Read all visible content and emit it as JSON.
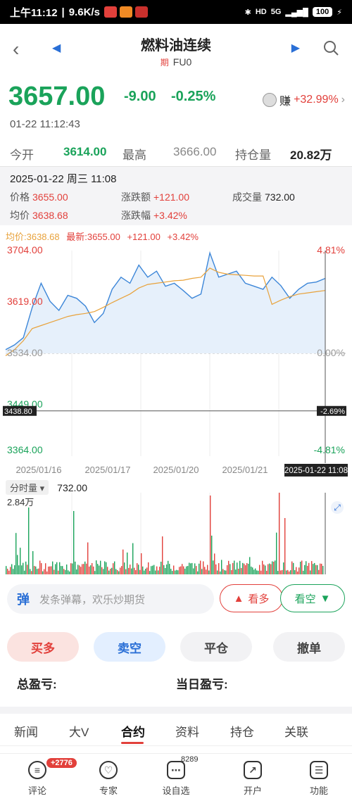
{
  "status_bar": {
    "time": "上午11:12",
    "speed": "9.6K/s",
    "net": "5G",
    "battery": "100"
  },
  "nav": {
    "title": "燃料油连续",
    "tag": "期",
    "code": "FU0"
  },
  "quote": {
    "price": "3657.00",
    "change": "-9.00",
    "change_pct": "-0.25%",
    "earn_label": "赚",
    "earn_value": "+32.99%",
    "timestamp": "01-22 11:12:43",
    "open_label": "今开",
    "open_value": "3614.00",
    "high_label": "最高",
    "high_value": "3666.00",
    "oi_label": "持仓量",
    "oi_value": "20.82万"
  },
  "popup": {
    "date": "2025-01-22 周三 11:08",
    "price_label": "价格",
    "price_value": "3655.00",
    "chg_label": "涨跌额",
    "chg_value": "+121.00",
    "vol_label": "成交量",
    "vol_value": "732.00",
    "avg_label": "均价",
    "avg_value": "3638.68",
    "pct_label": "涨跌幅",
    "pct_value": "+3.42%"
  },
  "legend": {
    "avg": "均价:3638.68",
    "latest": "最新:3655.00",
    "chg": "+121.00",
    "pct": "+3.42%"
  },
  "chart_data": {
    "type": "line",
    "x": [
      "2025/01/16",
      "2025/01/17",
      "2025/01/20",
      "2025/01/21"
    ],
    "ylim": [
      3364.0,
      3704.0
    ],
    "y_ticks_left": [
      "3704.00",
      "3619.00",
      "3534.00",
      "3449.00",
      "3364.00"
    ],
    "y_ticks_right": [
      "4.81%",
      "0.00%",
      "-4.81%"
    ],
    "crosshair_y": "3438.80",
    "crosshair_pct": "-2.69%",
    "crosshair_x": "2025-01-22 11:08",
    "series": [
      {
        "name": "最新",
        "values": [
          3540,
          3548,
          3560,
          3610,
          3650,
          3620,
          3605,
          3630,
          3625,
          3612,
          3585,
          3600,
          3640,
          3660,
          3650,
          3680,
          3660,
          3670,
          3645,
          3650,
          3638,
          3625,
          3632,
          3700,
          3660,
          3665,
          3670,
          3650,
          3645,
          3640,
          3660,
          3646,
          3625,
          3640,
          3650,
          3652,
          3658
        ]
      },
      {
        "name": "均价",
        "values": [
          3530,
          3540,
          3555,
          3575,
          3580,
          3585,
          3590,
          3595,
          3598,
          3600,
          3603,
          3610,
          3618,
          3625,
          3632,
          3642,
          3648,
          3650,
          3652,
          3654,
          3655,
          3658,
          3660,
          3675,
          3668,
          3665,
          3664,
          3663,
          3662,
          3662,
          3615,
          3622,
          3628,
          3632,
          3634,
          3636,
          3638
        ]
      }
    ],
    "volume": {
      "label": "分时量",
      "value": "732.00",
      "max": "2.84万"
    }
  },
  "danmu": {
    "placeholder": "发条弹幕，欢乐炒期货",
    "icon": "弹",
    "bull": "看多",
    "bear": "看空"
  },
  "trade": {
    "buy": "买多",
    "sell": "卖空",
    "close": "平仓",
    "cancel": "撤单"
  },
  "pnl": {
    "total": "总盈亏:",
    "today": "当日盈亏:"
  },
  "tabs": [
    "新闻",
    "大V",
    "合约",
    "资料",
    "持仓",
    "关联"
  ],
  "bottom_nav": [
    {
      "label": "评论",
      "icon": "comment-icon"
    },
    {
      "label": "专家",
      "icon": "expert-icon"
    },
    {
      "label": "设自选",
      "icon": "watchlist-icon"
    },
    {
      "label": "开户",
      "icon": "open-account-icon"
    },
    {
      "label": "功能",
      "icon": "menu-icon"
    }
  ],
  "badges": {
    "comment": "+2776",
    "watch": "8289"
  }
}
